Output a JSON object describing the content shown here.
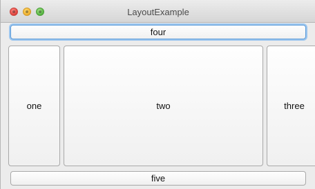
{
  "window": {
    "title": "LayoutExample"
  },
  "buttons": {
    "four": "four",
    "one": "one",
    "two": "two",
    "three": "three",
    "five": "five"
  }
}
